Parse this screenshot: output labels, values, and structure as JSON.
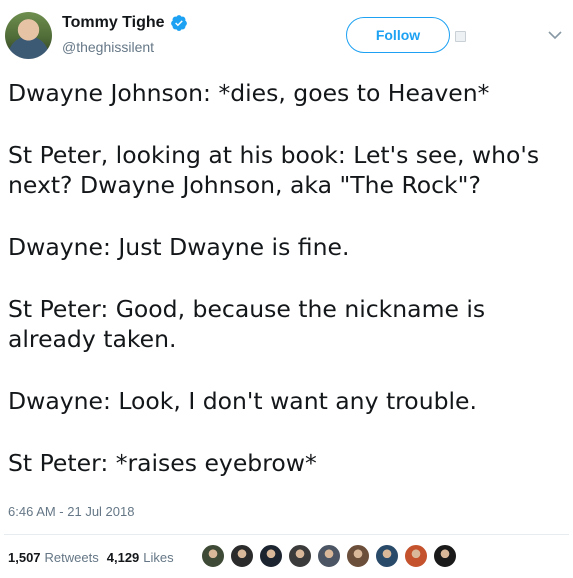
{
  "header": {
    "display_name": "Tommy Tighe",
    "handle": "@theghissilent",
    "follow_label": "Follow"
  },
  "tweet": {
    "lines": [
      "Dwayne Johnson: *dies, goes to Heaven*",
      "",
      "St Peter, looking at his book: Let's see, who's",
      "next? Dwayne Johnson, aka \"The Rock\"?",
      "",
      "Dwayne: Just Dwayne is fine.",
      "",
      "St Peter: Good, because the nickname is",
      "already taken.",
      "",
      "Dwayne: Look, I don't want any trouble.",
      "",
      "St Peter: *raises eyebrow*"
    ],
    "timestamp": "6:46 AM - 21 Jul 2018"
  },
  "stats": {
    "retweets_count": "1,507",
    "retweets_label": "Retweets",
    "likes_count": "4,129",
    "likes_label": "Likes"
  },
  "colors": {
    "accent": "#1da1f2",
    "text": "#14171a",
    "muted": "#657786"
  },
  "liker_avatars": [
    {
      "color": "#3e4a35"
    },
    {
      "color": "#2b2b2b"
    },
    {
      "color": "#1c2430"
    },
    {
      "color": "#3b3b3b"
    },
    {
      "color": "#4b5563"
    },
    {
      "color": "#6b4f3a"
    },
    {
      "color": "#2a4a6a"
    },
    {
      "color": "#c4522c"
    },
    {
      "color": "#1a1a1a"
    }
  ]
}
